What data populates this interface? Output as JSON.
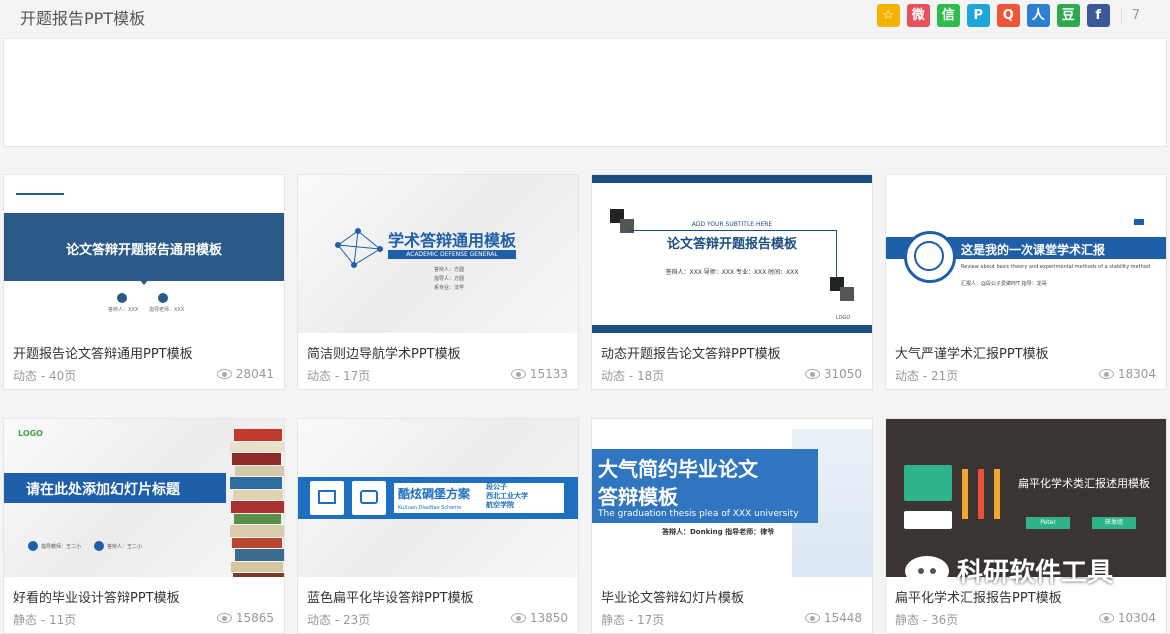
{
  "header": {
    "title": "开题报告PPT模板",
    "share_icons": [
      {
        "name": "favorite-icon",
        "color": "#f4b400",
        "glyph": "☆"
      },
      {
        "name": "weibo-icon",
        "color": "#e8505b",
        "glyph": "微"
      },
      {
        "name": "wechat-icon",
        "color": "#2dbb4e",
        "glyph": "信"
      },
      {
        "name": "qzone-icon",
        "color": "#1ea6dc",
        "glyph": "P"
      },
      {
        "name": "qq-icon",
        "color": "#f05537",
        "glyph": "Q"
      },
      {
        "name": "renren-icon",
        "color": "#2d7fd0",
        "glyph": "人"
      },
      {
        "name": "douban-icon",
        "color": "#2fa84f",
        "glyph": "豆"
      },
      {
        "name": "facebook-icon",
        "color": "#3b5998",
        "glyph": "f"
      }
    ],
    "share_count": "7"
  },
  "cards": [
    {
      "title": "开题报告论文答辩通用PPT模板",
      "meta": "动态 - 40页",
      "views": "28041",
      "thumb": {
        "heading": "论文答辩开题报告通用模板",
        "line1": "答辩人：XXX",
        "line2": "指导老师：XXX"
      }
    },
    {
      "title": "简洁则边导航学术PPT模板",
      "meta": "动态 - 17页",
      "views": "15133",
      "thumb": {
        "heading": "学术答辩通用模板",
        "sub": "ACADEMIC DEFENSE GENERAL",
        "l1": "答辩人：方圆",
        "l2": "指导人：方圆",
        "l3": "系专业：法学"
      }
    },
    {
      "title": "动态开题报告论文答辩PPT模板",
      "meta": "动态 - 18页",
      "views": "31050",
      "thumb": {
        "sub": "ADD YOUR SUBTITLE HERE",
        "heading": "论文答辩开题报告模板",
        "line": "答辩人：XXX   导师：XXX   专业：XXX  时间：XXX",
        "logo": "LOGO"
      }
    },
    {
      "title": "大气严谨学术汇报PPT模板",
      "meta": "动态 - 21页",
      "views": "18304",
      "thumb": {
        "heading": "这是我的一次课堂学术汇报",
        "sub": "Review about basic theory and experimental methods of a stability method",
        "line": "汇报人：@段公子爱做PPT      指导：龙哥"
      }
    },
    {
      "title": "好看的毕业设计答辩PPT模板",
      "meta": "静态 - 11页",
      "views": "15865",
      "thumb": {
        "logo": "LOGO",
        "heading": "请在此处添加幻灯片标题",
        "l1": "指导教师：王二小",
        "l2": "答辩人：王二小"
      }
    },
    {
      "title": "蓝色扁平化毕设答辩PPT模板",
      "meta": "动态 - 23页",
      "views": "13850",
      "thumb": {
        "heading": "酷炫碉堡方案",
        "sub": "KuXuan DiaoBao Scheme",
        "l1": "段公子",
        "l2": "西北工业大学",
        "l3": "航空学院"
      }
    },
    {
      "title": "毕业论文答辩幻灯片模板",
      "meta": "静态 - 17页",
      "views": "15448",
      "thumb": {
        "h1": "大气简约毕业论文",
        "h2": "答辩模板",
        "sub": "The graduation thesis plea of XXX university",
        "line": "答辩人：Donking     指导老师：律爷"
      }
    },
    {
      "title": "扁平化学术汇报报告PPT模板",
      "meta": "静态 - 36页",
      "views": "10304",
      "thumb": {
        "heading": "扁平化学术类汇报述用模板",
        "btn1": "Peter",
        "btn2": "研发组"
      }
    }
  ],
  "watermark": "科研软件工具"
}
